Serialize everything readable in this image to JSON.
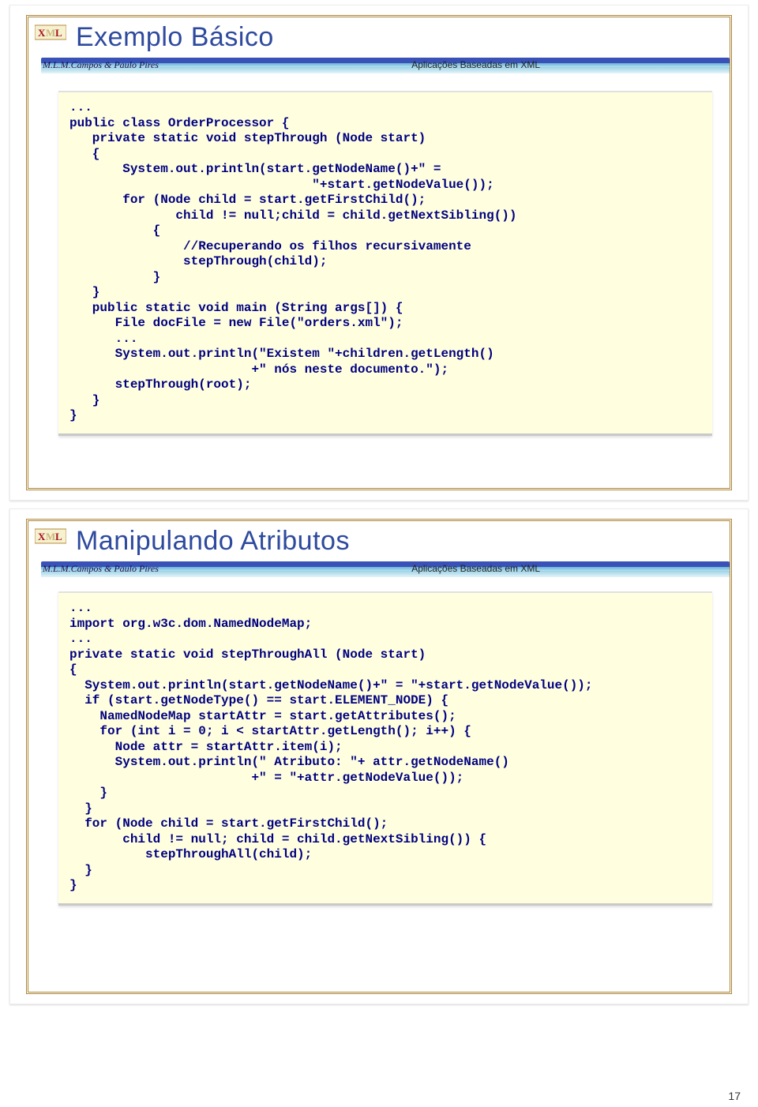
{
  "slide1": {
    "title": "Exemplo Básico",
    "author": "M.L.M.Campos & Paulo Pires",
    "subtitle_right": "Aplicações Baseadas em XML",
    "code": "...\npublic class OrderProcessor {\n   private static void stepThrough (Node start)\n   {\n       System.out.println(start.getNodeName()+\" =\n                                \"+start.getNodeValue());\n       for (Node child = start.getFirstChild();\n              child != null;child = child.getNextSibling())\n           {\n               //Recuperando os filhos recursivamente\n               stepThrough(child);\n           }\n   }\n   public static void main (String args[]) {\n      File docFile = new File(\"orders.xml\");\n      ...\n      System.out.println(\"Existem \"+children.getLength()\n                        +\" nós neste documento.\");\n      stepThrough(root);\n   }\n}"
  },
  "slide2": {
    "title": "Manipulando Atributos",
    "author": "M.L.M.Campos & Paulo Pires",
    "subtitle_right": "Aplicações Baseadas em XML",
    "code": "...\nimport org.w3c.dom.NamedNodeMap;\n...\nprivate static void stepThroughAll (Node start)\n{\n  System.out.println(start.getNodeName()+\" = \"+start.getNodeValue());\n  if (start.getNodeType() == start.ELEMENT_NODE) {\n    NamedNodeMap startAttr = start.getAttributes();\n    for (int i = 0; i < startAttr.getLength(); i++) {\n      Node attr = startAttr.item(i);\n      System.out.println(\" Atributo: \"+ attr.getNodeName()\n                        +\" = \"+attr.getNodeValue());\n    }\n  }\n  for (Node child = start.getFirstChild();\n       child != null; child = child.getNextSibling()) {\n          stepThroughAll(child);\n  }\n}"
  },
  "page_number": "17"
}
